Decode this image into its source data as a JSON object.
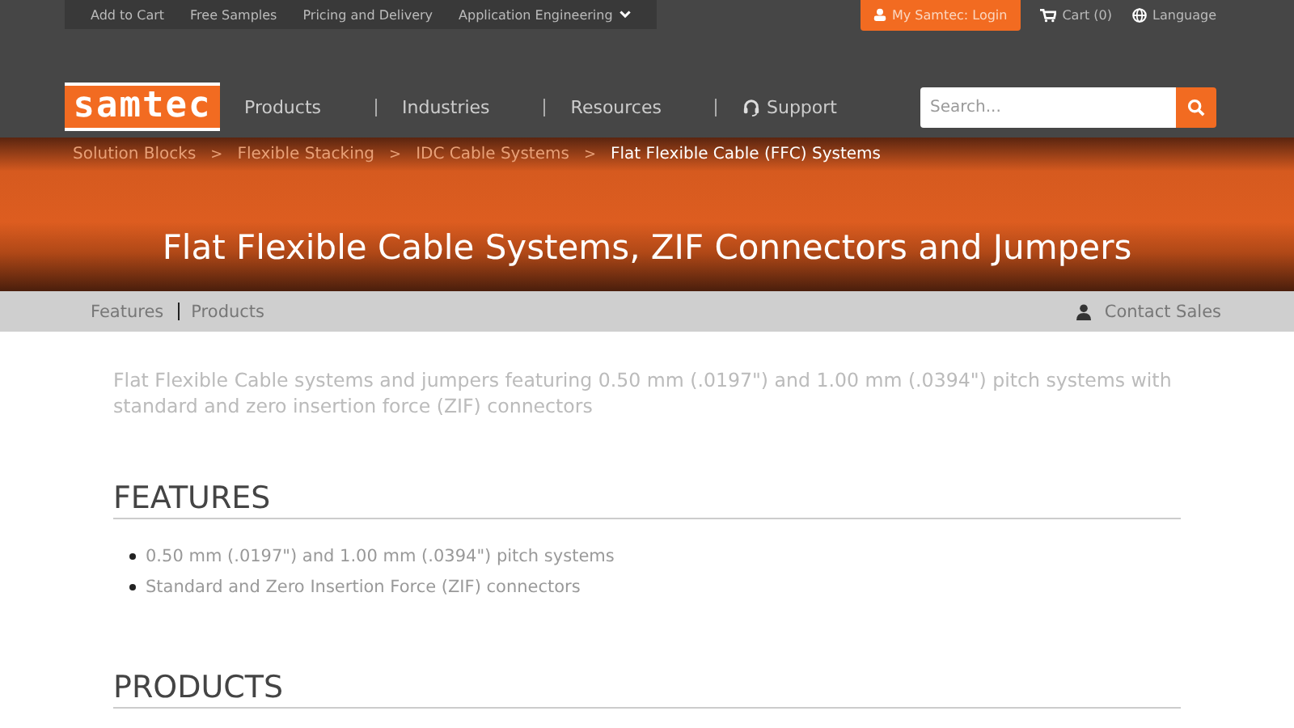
{
  "utility_links": [
    {
      "label": "Add to Cart",
      "dropdown": false
    },
    {
      "label": "Free Samples",
      "dropdown": false
    },
    {
      "label": "Pricing and Delivery",
      "dropdown": false
    },
    {
      "label": "Application Engineering",
      "dropdown": true
    }
  ],
  "account": {
    "login": "My Samtec: Login",
    "cart": "Cart (0)",
    "language": "Language"
  },
  "logo": "samtec",
  "nav": [
    "Products",
    "Industries",
    "Resources",
    "Support"
  ],
  "search": {
    "placeholder": "Search..."
  },
  "breadcrumbs": [
    {
      "label": "Solution Blocks",
      "current": false
    },
    {
      "label": "Flexible Stacking",
      "current": false
    },
    {
      "label": "IDC Cable Systems",
      "current": false
    },
    {
      "label": "Flat Flexible Cable (FFC) Systems",
      "current": true
    }
  ],
  "breadcrumb_separator": ">",
  "page_title": "Flat Flexible Cable Systems, ZIF Connectors and Jumpers",
  "subnav": [
    "Features",
    "Products"
  ],
  "contact": "Contact Sales",
  "intro": "Flat Flexible Cable systems and jumpers featuring 0.50 mm (.0197\") and 1.00 mm (.0394\") pitch systems with standard and zero insertion force (ZIF) connectors",
  "sections": [
    {
      "heading": "FEATURES",
      "items": [
        "0.50 mm (.0197\") and 1.00 mm (.0394\") pitch systems",
        "Standard and Zero Insertion Force (ZIF) connectors"
      ]
    },
    {
      "heading": "PRODUCTS"
    }
  ]
}
